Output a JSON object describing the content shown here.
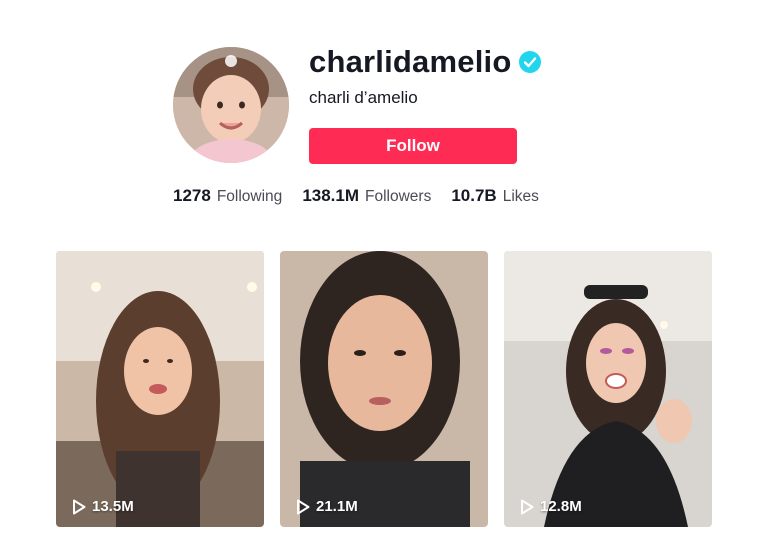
{
  "profile": {
    "username": "charlidamelio",
    "display_name": "charli d’amelio",
    "verified_icon": "verified-check-icon",
    "follow_label": "Follow"
  },
  "stats": [
    {
      "value": "1278",
      "label": "Following"
    },
    {
      "value": "138.1M",
      "label": "Followers"
    },
    {
      "value": "10.7B",
      "label": "Likes"
    }
  ],
  "videos": [
    {
      "views": "13.5M",
      "icon": "play-icon"
    },
    {
      "views": "21.1M",
      "icon": "play-icon"
    },
    {
      "views": "12.8M",
      "icon": "play-icon"
    }
  ],
  "colors": {
    "accent": "#fe2c55",
    "verified": "#20d5ec",
    "text": "#161823",
    "muted": "#4a4b55"
  }
}
